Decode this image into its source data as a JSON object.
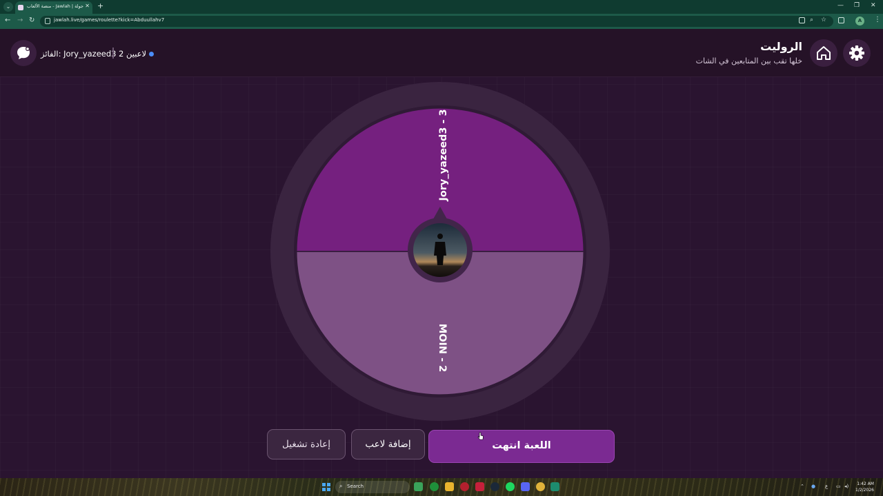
{
  "browser": {
    "tab_title": "جولة | Jawlah - منصة الألعاب ال...",
    "url": "jawlah.live/games/roulette?kick=Abduullahv7",
    "avatar_letter": "A"
  },
  "header": {
    "title": "الروليت",
    "subtitle": "خلها تقب بين المتابعين في الشات",
    "winner_label": "الفائز: Jory_yazeed3",
    "players_count": "2 لاعبين"
  },
  "wheel": {
    "segments": [
      {
        "label": "Jory_yazeed3 - 3",
        "color": "#75207f"
      },
      {
        "label": "MOIN - 2",
        "color": "#7e5185"
      }
    ],
    "center_icon": "silhouette-avatar"
  },
  "buttons": {
    "end_label": "اللعبة انتهت",
    "add_label": "إضافة لاعب",
    "restart_label": "إعادة تشغيل"
  },
  "taskbar": {
    "search_placeholder": "Search",
    "lang": "ع",
    "time": "1:42 AM",
    "date": "1/2/2026"
  },
  "colors": {
    "accent": "#7b2a92",
    "background": "#2a1430",
    "chrome_green": "#1d5a49"
  }
}
